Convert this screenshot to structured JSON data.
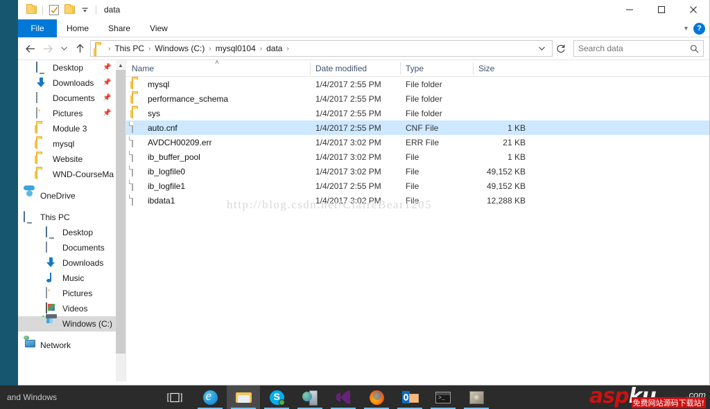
{
  "window": {
    "title": "data",
    "quick_access": [
      {
        "name": "folder-icon",
        "label": "Folder"
      },
      {
        "name": "properties-icon",
        "label": "Properties"
      },
      {
        "name": "new-folder-icon",
        "label": "New folder"
      },
      {
        "name": "chevron-down-icon",
        "label": "Customize Quick Access Toolbar"
      }
    ],
    "controls": {
      "minimize": "—",
      "maximize": "□",
      "close": "✕"
    }
  },
  "ribbon": {
    "tabs": [
      {
        "label": "File",
        "active": true
      },
      {
        "label": "Home",
        "active": false
      },
      {
        "label": "Share",
        "active": false
      },
      {
        "label": "View",
        "active": false
      }
    ],
    "collapse_icon": "chevron-down-icon",
    "help_label": "?"
  },
  "address": {
    "back_icon": "←",
    "forward_icon": "→",
    "recent_icon": "⌄",
    "up_icon": "↑",
    "breadcrumbs": [
      "This PC",
      "Windows (C:)",
      "mysql0104",
      "data"
    ],
    "separator": "›",
    "dropdown_icon": "⌄",
    "refresh_icon": "↻"
  },
  "search": {
    "placeholder": "Search data",
    "value": "",
    "icon": "search-icon"
  },
  "sidebar": {
    "quick_access_items": [
      {
        "label": "Desktop",
        "icon": "monitor-icon",
        "pinned": true
      },
      {
        "label": "Downloads",
        "icon": "download-arrow-icon",
        "pinned": true
      },
      {
        "label": "Documents",
        "icon": "document-icon",
        "pinned": true
      },
      {
        "label": "Pictures",
        "icon": "picture-icon",
        "pinned": true
      },
      {
        "label": "Module 3",
        "icon": "folder-icon",
        "pinned": false
      },
      {
        "label": "mysql",
        "icon": "folder-icon",
        "pinned": false
      },
      {
        "label": "Website",
        "icon": "folder-icon",
        "pinned": false
      },
      {
        "label": "WND-CourseMa",
        "icon": "folder-icon",
        "pinned": false
      }
    ],
    "onedrive": {
      "label": "OneDrive",
      "icon": "cloud-icon"
    },
    "this_pc": {
      "label": "This PC",
      "icon": "computer-icon"
    },
    "this_pc_items": [
      {
        "label": "Desktop",
        "icon": "monitor-icon",
        "selected": false
      },
      {
        "label": "Documents",
        "icon": "document-icon",
        "selected": false
      },
      {
        "label": "Downloads",
        "icon": "download-arrow-icon",
        "selected": false
      },
      {
        "label": "Music",
        "icon": "music-note-icon",
        "selected": false
      },
      {
        "label": "Pictures",
        "icon": "picture-icon",
        "selected": false
      },
      {
        "label": "Videos",
        "icon": "video-icon",
        "selected": false
      },
      {
        "label": "Windows (C:)",
        "icon": "drive-icon",
        "selected": true
      }
    ],
    "network": {
      "label": "Network",
      "icon": "network-icon"
    }
  },
  "columns": [
    {
      "label": "Name",
      "sorted": true,
      "sort_icon": "˄"
    },
    {
      "label": "Date modified",
      "sorted": false
    },
    {
      "label": "Type",
      "sorted": false
    },
    {
      "label": "Size",
      "sorted": false
    }
  ],
  "files": [
    {
      "name": "mysql",
      "date": "1/4/2017 2:55 PM",
      "type": "File folder",
      "size": "",
      "icon": "folder-icon",
      "selected": false
    },
    {
      "name": "performance_schema",
      "date": "1/4/2017 2:55 PM",
      "type": "File folder",
      "size": "",
      "icon": "folder-icon",
      "selected": false
    },
    {
      "name": "sys",
      "date": "1/4/2017 2:55 PM",
      "type": "File folder",
      "size": "",
      "icon": "folder-icon",
      "selected": false
    },
    {
      "name": "auto.cnf",
      "date": "1/4/2017 2:55 PM",
      "type": "CNF File",
      "size": "1 KB",
      "icon": "file-icon",
      "selected": true
    },
    {
      "name": "AVDCH00209.err",
      "date": "1/4/2017 3:02 PM",
      "type": "ERR File",
      "size": "21 KB",
      "icon": "file-icon",
      "selected": false
    },
    {
      "name": "ib_buffer_pool",
      "date": "1/4/2017 3:02 PM",
      "type": "File",
      "size": "1 KB",
      "icon": "file-icon",
      "selected": false
    },
    {
      "name": "ib_logfile0",
      "date": "1/4/2017 3:02 PM",
      "type": "File",
      "size": "49,152 KB",
      "icon": "file-icon",
      "selected": false
    },
    {
      "name": "ib_logfile1",
      "date": "1/4/2017 2:55 PM",
      "type": "File",
      "size": "49,152 KB",
      "icon": "file-icon",
      "selected": false
    },
    {
      "name": "ibdata1",
      "date": "1/4/2017 3:02 PM",
      "type": "File",
      "size": "12,288 KB",
      "icon": "file-icon",
      "selected": false
    }
  ],
  "watermark": {
    "url": "http://blog.csdn.net/ClaireBear1205"
  },
  "taskbar": {
    "left_text": "and Windows",
    "task_view_icon": "task-view-icon",
    "items": [
      {
        "name": "edge-icon",
        "label": "Microsoft Edge",
        "active": false,
        "running": true
      },
      {
        "name": "file-explorer-icon",
        "label": "File Explorer",
        "active": true,
        "running": true
      },
      {
        "name": "skype-icon",
        "label": "Skype",
        "active": false,
        "running": true
      },
      {
        "name": "server-manager-icon",
        "label": "Server Manager",
        "active": false,
        "running": true
      },
      {
        "name": "visual-studio-icon",
        "label": "Visual Studio",
        "active": false,
        "running": true
      },
      {
        "name": "firefox-icon",
        "label": "Firefox",
        "active": false,
        "running": true
      },
      {
        "name": "outlook-icon",
        "label": "Outlook",
        "active": false,
        "running": true
      },
      {
        "name": "command-prompt-icon",
        "label": "Command Prompt",
        "active": false,
        "running": true
      },
      {
        "name": "paint-icon",
        "label": "Paint",
        "active": false,
        "running": true
      }
    ]
  },
  "branding": {
    "asp": "asp",
    "ku": "ku",
    "com": ".com",
    "tagline": "免费网站源码下载站!"
  },
  "colors": {
    "accent": "#0078d7",
    "selection": "#cde8ff",
    "nav_selection": "#d9d9d9",
    "taskbar": "#2b2b2b",
    "brand_red": "#cc1111"
  }
}
